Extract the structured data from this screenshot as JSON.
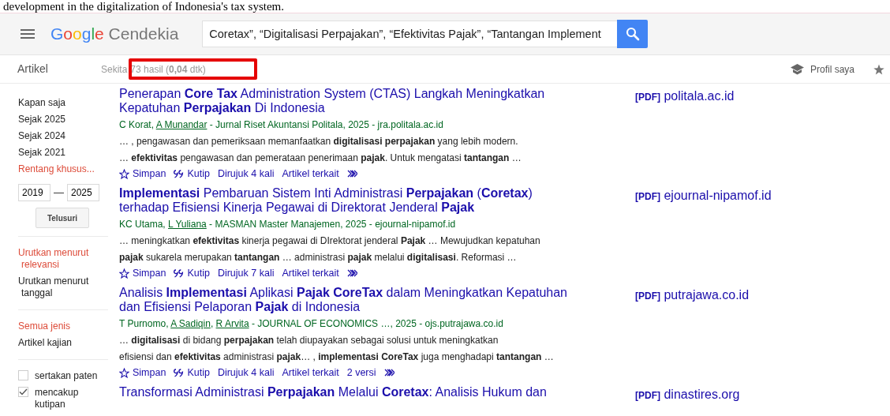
{
  "caption": "development in the digitalization of Indonesia's tax system.",
  "header": {
    "logo": {
      "brand": "Google",
      "product": "Cendekia"
    },
    "search": {
      "value": "Coretax”, “Digitalisasi Perpajakan”, “Efektivitas Pajak”, “Tantangan Implement"
    }
  },
  "subbar": {
    "section": "Artikel",
    "results_prefix": "Sekita",
    "results_count": {
      "text": "73 hasil (**0,04** dtk)",
      "highlighted": true
    },
    "profile": "Profil saya"
  },
  "sidebar": {
    "time_filters": [
      {
        "label": "Kapan saja",
        "selected": false
      },
      {
        "label": "Sejak 2025",
        "selected": false
      },
      {
        "label": "Sejak 2024",
        "selected": false
      },
      {
        "label": "Sejak 2021",
        "selected": false
      },
      {
        "label": "Rentang khusus...",
        "selected": true
      }
    ],
    "year_from": "2019",
    "year_separator": "—",
    "year_to": "2025",
    "search_button": "Telusuri",
    "sort": [
      {
        "label": "Urutkan menurut relevansi",
        "selected": true
      },
      {
        "label": "Urutkan menurut tanggal",
        "selected": false
      }
    ],
    "types": [
      {
        "label": "Semua jenis",
        "selected": true
      },
      {
        "label": "Artikel kajian",
        "selected": false
      }
    ],
    "options": [
      {
        "label": "sertakan paten",
        "checked": false
      },
      {
        "label": "mencakup kutipan",
        "checked": true
      }
    ]
  },
  "results": [
    {
      "title": "Penerapan **Core Tax** Administration System (CTAS) Langkah Meningkatkan Kepatuhan **Perpajakan** Di Indonesia",
      "authors": [
        {
          "name": "C Korat",
          "linked": false
        },
        {
          "name": "A Munandar",
          "linked": true
        }
      ],
      "author_separator": ",",
      "source": " - Jurnal Riset Akuntansi Politala, 2025 - jra.politala.ac.id",
      "snippet": [
        "… , pengawasan dan pemeriksaan memanfaatkan **digitalisasi perpajakan** yang lebih modern.",
        "… **efektivitas** pengawasan dan pemerataan penerimaan **pajak**. Untuk mengatasi **tantangan** …"
      ],
      "actions": [
        {
          "kind": "save",
          "label": "Simpan"
        },
        {
          "kind": "cite",
          "label": "Kutip"
        },
        {
          "kind": "link",
          "label": "Dirujuk 4 kali"
        },
        {
          "kind": "link",
          "label": "Artikel terkait"
        },
        {
          "kind": "more"
        }
      ],
      "pdf": {
        "tag": "[PDF]",
        "domain": "politala.ac.id"
      }
    },
    {
      "title": "**Implementasi** Pembaruan Sistem Inti Administrasi **Perpajakan** (**Coretax**) terhadap Efisiensi Kinerja Pegawai di Direktorat Jenderal **Pajak**",
      "authors": [
        {
          "name": "KC Utama",
          "linked": false
        },
        {
          "name": "L Yuliana",
          "linked": true
        }
      ],
      "author_separator": ",",
      "source": " - MASMAN Master Manajemen, 2025 - ejournal-nipamof.id",
      "snippet": [
        "… meningkatkan **efektivitas** kinerja pegawai di DIrektorat jenderal **Pajak** … Mewujudkan kepatuhan",
        "**pajak** sukarela merupakan **tantangan** … administrasi **pajak** melalui **digitalisasi**. Reformasi …"
      ],
      "actions": [
        {
          "kind": "save",
          "label": "Simpan"
        },
        {
          "kind": "cite",
          "label": "Kutip"
        },
        {
          "kind": "link",
          "label": "Dirujuk 7 kali"
        },
        {
          "kind": "link",
          "label": "Artikel terkait"
        },
        {
          "kind": "more"
        }
      ],
      "pdf": {
        "tag": "[PDF]",
        "domain": "ejournal-nipamof.id"
      }
    },
    {
      "title": "Analisis **Implementasi** Aplikasi **Pajak CoreTax** dalam Meningkatkan Kepatuhan dan Efisiensi Pelaporan **Pajak** di Indonesia",
      "authors": [
        {
          "name": "T Purnomo",
          "linked": false
        },
        {
          "name": "A Sadiqin",
          "linked": true
        },
        {
          "name": "R Arvita",
          "linked": true
        }
      ],
      "author_separator": ",",
      "source": " - JOURNAL OF ECONOMICS …, 2025 - ojs.putrajawa.co.id",
      "snippet": [
        "… **digitalisasi** di bidang **perpajakan** telah diupayakan sebagai solusi untuk meningkatkan",
        "efisiensi dan **efektivitas** administrasi **pajak**… , **implementasi CoreTax** juga menghadapi **tantangan** …"
      ],
      "actions": [
        {
          "kind": "save",
          "label": "Simpan"
        },
        {
          "kind": "cite",
          "label": "Kutip"
        },
        {
          "kind": "link",
          "label": "Dirujuk 4 kali"
        },
        {
          "kind": "link",
          "label": "Artikel terkait"
        },
        {
          "kind": "link",
          "label": "2 versi"
        },
        {
          "kind": "more"
        }
      ],
      "pdf": {
        "tag": "[PDF]",
        "domain": "putrajawa.co.id"
      }
    },
    {
      "title": "Transformasi Administrasi **Perpajakan** Melalui **Coretax**: Analisis Hukum dan",
      "pdf": {
        "tag": "[PDF]",
        "domain": "dinastires.org"
      }
    }
  ]
}
